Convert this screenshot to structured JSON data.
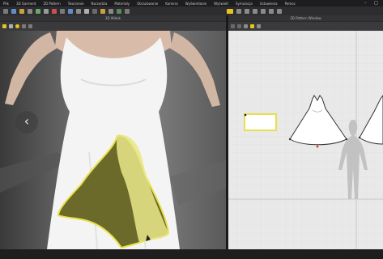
{
  "menu": {
    "items": [
      "Plik",
      "3D Garment",
      "2D Pattern",
      "Tworzenie",
      "Narzędzia",
      "Materiały",
      "Obrazowanie",
      "Kamera",
      "Wyświetlanie",
      "Wyświetl",
      "Symulacja",
      "Ustawienia",
      "Pomoc"
    ]
  },
  "panels": {
    "left_title": "3D Widok",
    "right_title": "2D Pattern Window"
  },
  "colors": {
    "accent_yellow": "#e8e04a",
    "selection_fill": "#6b6a2a",
    "garment_white": "#f4f4f4",
    "grid_bg": "#e9e9e9",
    "red_point": "#d23b2b"
  },
  "icons": {
    "nav": "chevron-left-icon"
  }
}
